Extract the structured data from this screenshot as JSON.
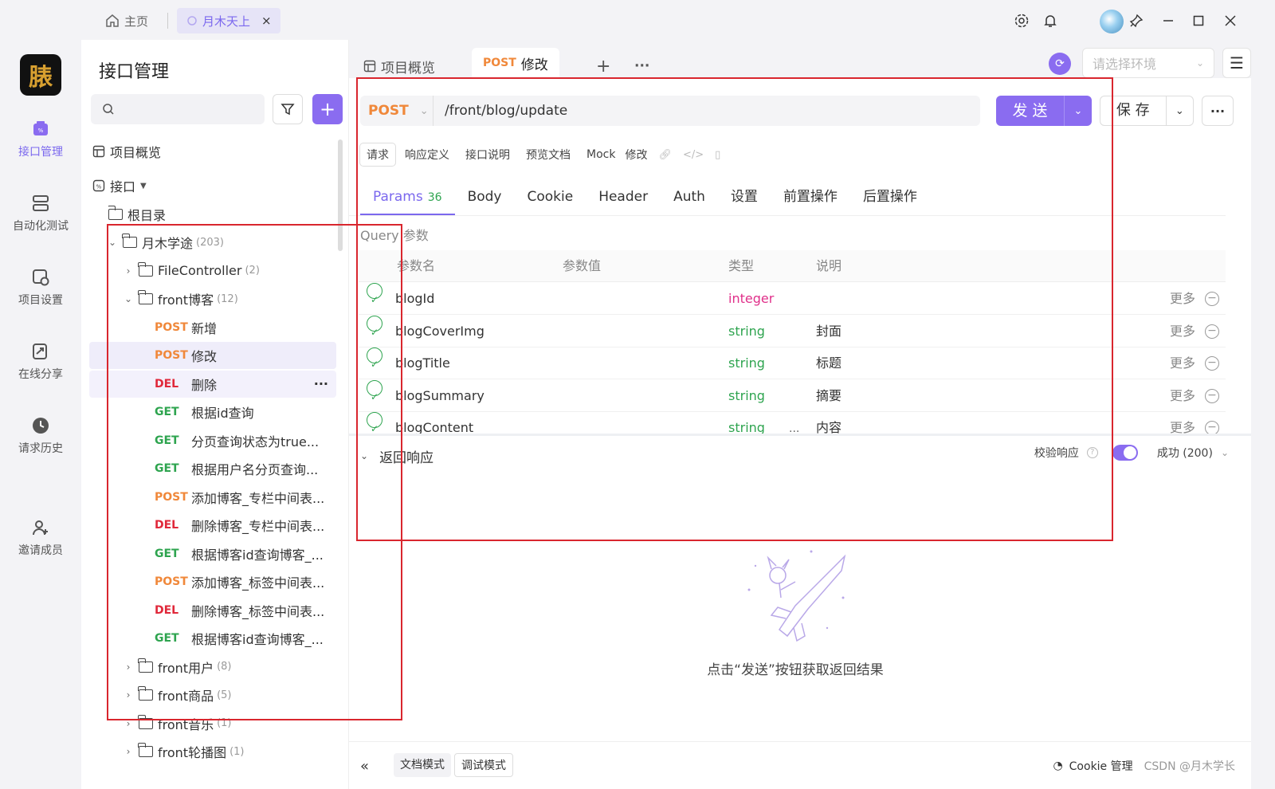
{
  "titlebar": {
    "home_tab": "主页",
    "project_tab": "月木天上",
    "close": "×"
  },
  "leftnav": {
    "logo_text": "脿",
    "items": [
      {
        "label": "接口管理",
        "icon": "api-icon",
        "active": true
      },
      {
        "label": "自动化测试",
        "icon": "automation-icon",
        "active": false
      },
      {
        "label": "项目设置",
        "icon": "project-settings-icon",
        "active": false
      },
      {
        "label": "在线分享",
        "icon": "share-icon",
        "active": false
      },
      {
        "label": "请求历史",
        "icon": "history-icon",
        "active": false
      },
      {
        "label": "邀请成员",
        "icon": "invite-icon",
        "active": false
      }
    ]
  },
  "sidebar": {
    "title": "接口管理",
    "overview": "项目概览",
    "apis_section": "接口",
    "root": "根目录",
    "tree": [
      {
        "type": "folder",
        "name": "月木学途",
        "count": "(203)",
        "expanded": true
      },
      {
        "type": "folder",
        "name": "FileController",
        "count": "(2)",
        "expanded": false
      },
      {
        "type": "folder",
        "name": "front博客",
        "count": "(12)",
        "expanded": true
      },
      {
        "type": "api",
        "method": "POST",
        "name": "新增"
      },
      {
        "type": "api",
        "method": "POST",
        "name": "修改"
      },
      {
        "type": "api",
        "method": "DEL",
        "name": "删除"
      },
      {
        "type": "api",
        "method": "GET",
        "name": "根据id查询"
      },
      {
        "type": "api",
        "method": "GET",
        "name": "分页查询状态为true..."
      },
      {
        "type": "api",
        "method": "GET",
        "name": "根据用户名分页查询..."
      },
      {
        "type": "api",
        "method": "POST",
        "name": "添加博客_专栏中间表..."
      },
      {
        "type": "api",
        "method": "DEL",
        "name": "删除博客_专栏中间表..."
      },
      {
        "type": "api",
        "method": "GET",
        "name": "根据博客id查询博客_..."
      },
      {
        "type": "api",
        "method": "POST",
        "name": "添加博客_标签中间表..."
      },
      {
        "type": "api",
        "method": "DEL",
        "name": "删除博客_标签中间表..."
      },
      {
        "type": "api",
        "method": "GET",
        "name": "根据博客id查询博客_..."
      },
      {
        "type": "folder",
        "name": "front用户",
        "count": "(8)",
        "expanded": false
      },
      {
        "type": "folder",
        "name": "front商品",
        "count": "(5)",
        "expanded": false
      },
      {
        "type": "folder",
        "name": "front音乐",
        "count": "(1)",
        "expanded": false
      },
      {
        "type": "folder",
        "name": "front轮播图",
        "count": "(1)",
        "expanded": false
      }
    ]
  },
  "main": {
    "tabs": {
      "overview": "项目概览",
      "active_method": "POST",
      "active_name": "修改",
      "add": "+",
      "more": "···"
    },
    "env_placeholder": "请选择环境",
    "request": {
      "method": "POST",
      "url": "/front/blog/update",
      "send_label": "发 送",
      "save_label": "保 存"
    },
    "subtabs": [
      "请求",
      "响应定义",
      "接口说明",
      "预览文档",
      "Mock",
      "修改"
    ],
    "param_tabs": [
      {
        "label": "Params",
        "badge": "36"
      },
      {
        "label": "Body"
      },
      {
        "label": "Cookie"
      },
      {
        "label": "Header"
      },
      {
        "label": "Auth"
      },
      {
        "label": "设置"
      },
      {
        "label": "前置操作"
      },
      {
        "label": "后置操作"
      }
    ],
    "query_label": "Query 参数",
    "columns": {
      "name": "参数名",
      "value": "参数值",
      "type": "类型",
      "desc": "说明"
    },
    "params": [
      {
        "name": "blogId",
        "type": "integer",
        "desc": "",
        "more": "更多"
      },
      {
        "name": "blogCoverImg",
        "type": "string",
        "desc": "封面",
        "more": "更多"
      },
      {
        "name": "blogTitle",
        "type": "string",
        "desc": "标题",
        "more": "更多"
      },
      {
        "name": "blogSummary",
        "type": "string",
        "desc": "摘要",
        "more": "更多"
      },
      {
        "name": "blogContent",
        "type": "string",
        "desc": "内容",
        "more": "更多"
      }
    ],
    "response": {
      "title": "返回响应",
      "validate_label": "校验响应",
      "status": "成功 (200)",
      "empty_text": "点击“发送”按钮获取返回结果"
    },
    "bottombar": {
      "doc_mode": "文档模式",
      "debug_mode": "调试模式",
      "cookie_manage": "Cookie 管理",
      "watermark": "CSDN @月木学长"
    }
  },
  "colors": {
    "accent": "#8a6cf0",
    "post": "#f0883a",
    "get": "#2ea44f",
    "del": "#e0283a",
    "annotation": "#d9262e"
  }
}
